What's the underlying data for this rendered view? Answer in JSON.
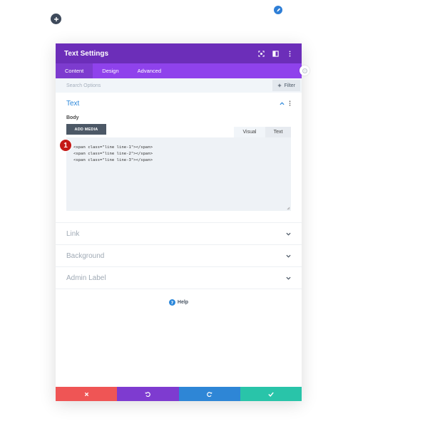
{
  "modal": {
    "title": "Text Settings",
    "tabs": [
      "Content",
      "Design",
      "Advanced"
    ],
    "search_placeholder": "Search Options",
    "filter_label": "Filter"
  },
  "text_section": {
    "title": "Text",
    "body_label": "Body",
    "add_media_label": "ADD MEDIA",
    "editor_tabs": [
      "Visual",
      "Text"
    ],
    "code_lines": [
      "<span class=\"line line-1\"></span>",
      "<span class=\"line line-2\"></span>",
      "<span class=\"line line-3\"></span>"
    ]
  },
  "collapsed_sections": [
    "Link",
    "Background",
    "Admin Label"
  ],
  "help_label": "Help",
  "badge_number": "1",
  "colors": {
    "header": "#6c2eb9",
    "tabs_bar": "#8f42ec",
    "accent_blue": "#2b87da",
    "footer_cancel": "#ef5555",
    "footer_undo": "#7e3bd0",
    "footer_redo": "#2e86d6",
    "footer_save": "#29c4a9"
  }
}
